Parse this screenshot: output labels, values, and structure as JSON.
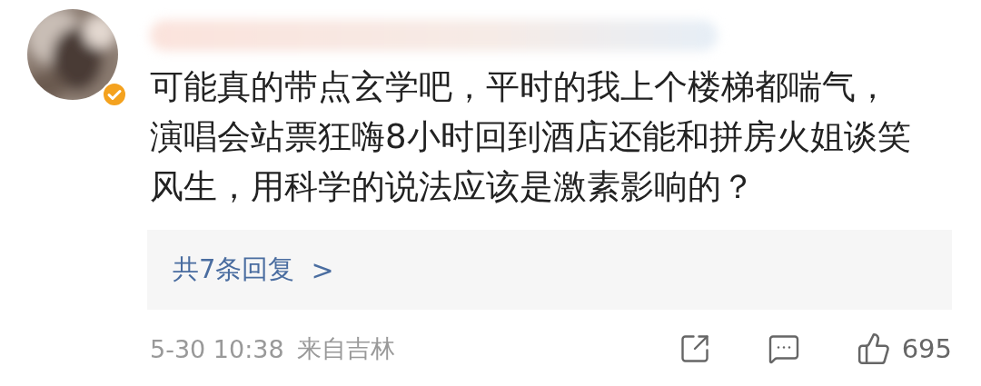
{
  "comment": {
    "avatar": {
      "kind": "picture",
      "verified": true
    },
    "lines": [
      "可能真的带点玄学吧，平时的我上个楼梯都喘气，",
      "演唱会站票狂嗨8小时回到酒店还能和拼房火姐谈笑",
      "风生，用科学的说法应该是激素影响的？"
    ],
    "replies": {
      "label": "共7条回复",
      "chevron": ">"
    },
    "time": "5-30 10:38",
    "location": "来自吉林",
    "likes": "695"
  }
}
